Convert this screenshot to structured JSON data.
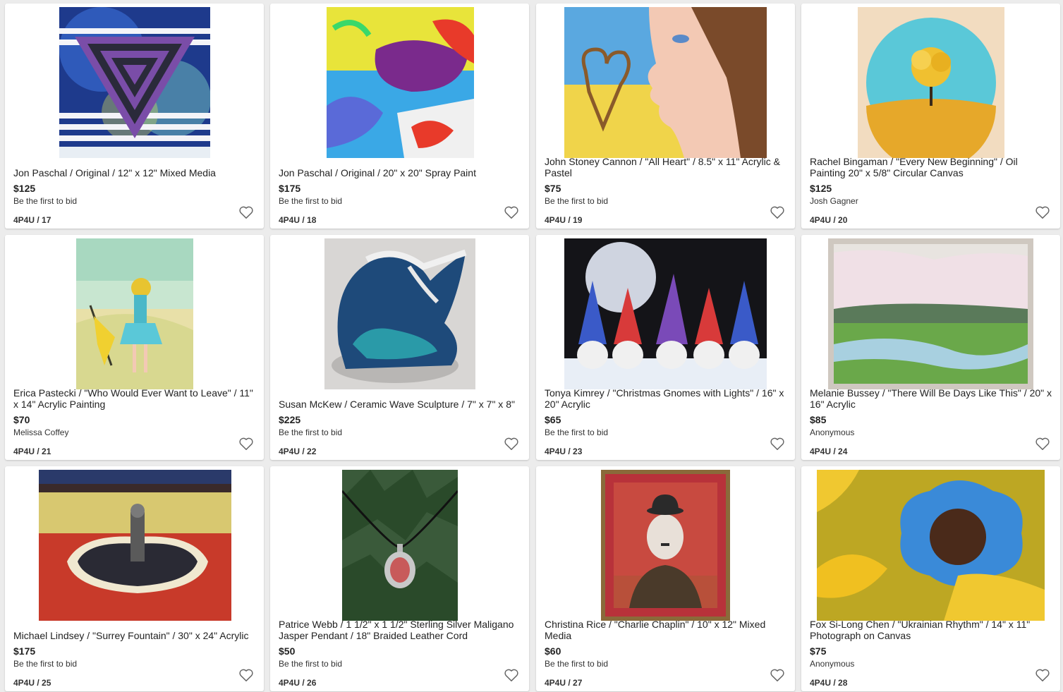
{
  "lots": [
    {
      "title": "Jon Paschal / Original / 12\" x 12\" Mixed Media",
      "price": "$125",
      "bid_status": "Be the first to bid",
      "lot": "4P4U / 17",
      "image": "geometric-triangle-artwork"
    },
    {
      "title": "Jon Paschal / Original / 20\" x 20\" Spray Paint",
      "price": "$175",
      "bid_status": "Be the first to bid",
      "lot": "4P4U / 18",
      "image": "spray-paint-abstract-artwork"
    },
    {
      "title": "John Stoney Cannon / \"All Heart\" / 8.5\" x 11\" Acrylic & Pastel",
      "price": "$75",
      "bid_status": "Be the first to bid",
      "lot": "4P4U / 19",
      "image": "girl-profile-heart-artwork"
    },
    {
      "title": "Rachel Bingaman / \"Every New Beginning\" / Oil Painting 20\" x 5/8\" Circular Canvas",
      "price": "$125",
      "bid_status": "Josh Gagner",
      "lot": "4P4U / 20",
      "image": "golden-tree-circle-artwork"
    },
    {
      "title": "Erica Pastecki / \"Who Would Ever Want to Leave\" / 11\" x 14\" Acrylic Painting",
      "price": "$70",
      "bid_status": "Melissa Coffey",
      "lot": "4P4U / 21",
      "image": "woman-umbrella-artwork"
    },
    {
      "title": "Susan McKew / Ceramic Wave Sculpture / 7\" x 7\" x 8\"",
      "price": "$225",
      "bid_status": "Be the first to bid",
      "lot": "4P4U / 22",
      "image": "ceramic-wave-sculpture"
    },
    {
      "title": "Tonya Kimrey / \"Christmas Gnomes with Lights\" / 16\" x 20\" Acrylic",
      "price": "$65",
      "bid_status": "Be the first to bid",
      "lot": "4P4U / 23",
      "image": "christmas-gnomes-artwork"
    },
    {
      "title": "Melanie Bussey / \"There Will Be Days Like This\" / 20\" x 16\" Acrylic",
      "price": "$85",
      "bid_status": "Anonymous",
      "lot": "4P4U / 24",
      "image": "marsh-landscape-artwork"
    },
    {
      "title": "Michael Lindsey / \"Surrey Fountain\" / 30\" x 24\" Acrylic",
      "price": "$175",
      "bid_status": "Be the first to bid",
      "lot": "4P4U / 25",
      "image": "fountain-plaza-artwork"
    },
    {
      "title": "Patrice Webb / 1 1/2\" x 1 1/2\" Sterling Silver Maligano Jasper Pendant / 18\" Braided Leather Cord",
      "price": "$50",
      "bid_status": "Be the first to bid",
      "lot": "4P4U / 26",
      "image": "jasper-pendant-photo"
    },
    {
      "title": "Christina Rice / \"Charlie Chaplin\" / 10\" x 12\" Mixed Media",
      "price": "$60",
      "bid_status": "Be the first to bid",
      "lot": "4P4U / 27",
      "image": "charlie-chaplin-portrait"
    },
    {
      "title": "Fox Si-Long Chen / \"Ukrainian Rhythm\" / 14\" x 11\" Photograph on Canvas",
      "price": "$75",
      "bid_status": "Anonymous",
      "lot": "4P4U / 28",
      "image": "sunflower-photograph"
    }
  ],
  "icons": {
    "favorite": "heart-outline-icon"
  },
  "colors": {
    "background": "#ececec",
    "card": "#ffffff",
    "text": "#222222",
    "heart": "#666666"
  }
}
